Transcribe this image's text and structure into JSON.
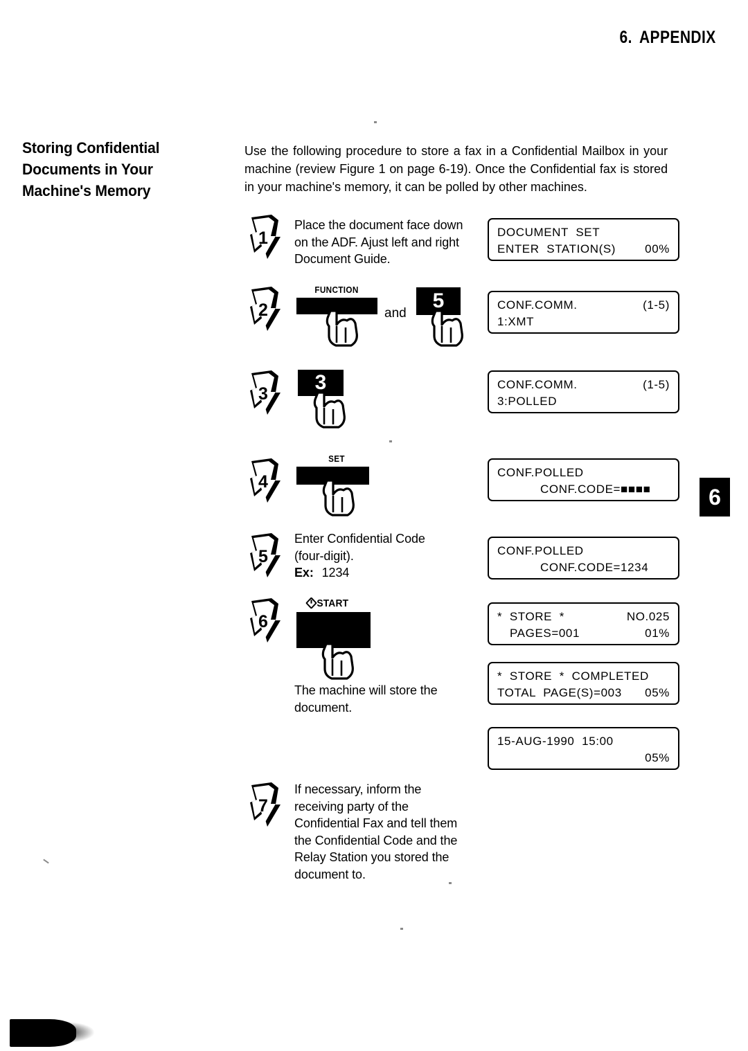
{
  "header": {
    "chapter_number": "6.",
    "chapter_title": "APPENDIX"
  },
  "page_tab": {
    "number": "6"
  },
  "side_heading": "Storing Confidential Documents in Your Machine's Memory",
  "intro": "Use the following procedure to store a fax in a Confidential Mailbox in your machine (review Figure 1 on page 6-19). Once the Confidential fax is stored in your machine's memory, it can be polled by other machines.",
  "steps": [
    {
      "number": "1",
      "text": "Place the document face down on the ADF. Ajust left and right Document Guide."
    },
    {
      "number": "2",
      "key_label": "FUNCTION",
      "conjunction": "and",
      "second_key": "5"
    },
    {
      "number": "3",
      "key": "3"
    },
    {
      "number": "4",
      "key_label": "SET"
    },
    {
      "number": "5",
      "text_line1": "Enter Confidential Code",
      "text_line2": "(four-digit).",
      "example_label": "Ex:",
      "example_value": "1234"
    },
    {
      "number": "6",
      "key_label": "START",
      "key_icon": "power-diamond-icon",
      "note": "The machine will store the document."
    },
    {
      "number": "7",
      "text": "If necessary, inform the receiving party of the Confidential Fax and tell them the Confidential Code and the Relay Station you stored the document to."
    }
  ],
  "displays": [
    {
      "name": "document-set",
      "line1_left": "DOCUMENT  SET",
      "line1_right": "",
      "line2_left": "ENTER  STATION(S)",
      "line2_right": "00%"
    },
    {
      "name": "conf-comm-xmt",
      "line1_left": "CONF.COMM.",
      "line1_right": "(1-5)",
      "line2_left": "1:XMT",
      "line2_right": ""
    },
    {
      "name": "conf-comm-polled",
      "line1_left": "CONF.COMM.",
      "line1_right": "(1-5)",
      "line2_left": "3:POLLED",
      "line2_right": ""
    },
    {
      "name": "conf-polled-code-blank",
      "line1_left": "CONF.POLLED",
      "line1_right": "",
      "line2_left": "CONF.CODE=■■■■",
      "line2_right": ""
    },
    {
      "name": "conf-polled-code-entered",
      "line1_left": "CONF.POLLED",
      "line1_right": "",
      "line2_left": "CONF.CODE=1234",
      "line2_right": ""
    },
    {
      "name": "store-progress",
      "line1_left": "*  STORE  *",
      "line1_right": "NO.025",
      "line2_left": "PAGES=001",
      "line2_right": "01%"
    },
    {
      "name": "store-completed",
      "line1_left": "*  STORE  *  COMPLETED",
      "line1_right": "",
      "line2_left": "TOTAL  PAGE(S)=003",
      "line2_right": "05%"
    },
    {
      "name": "standby-clock",
      "line1_left": "15-AUG-1990  15:00",
      "line1_right": "",
      "line2_left": "",
      "line2_right": "05%"
    }
  ],
  "colors": {
    "ink": "#000000",
    "paper": "#ffffff"
  }
}
